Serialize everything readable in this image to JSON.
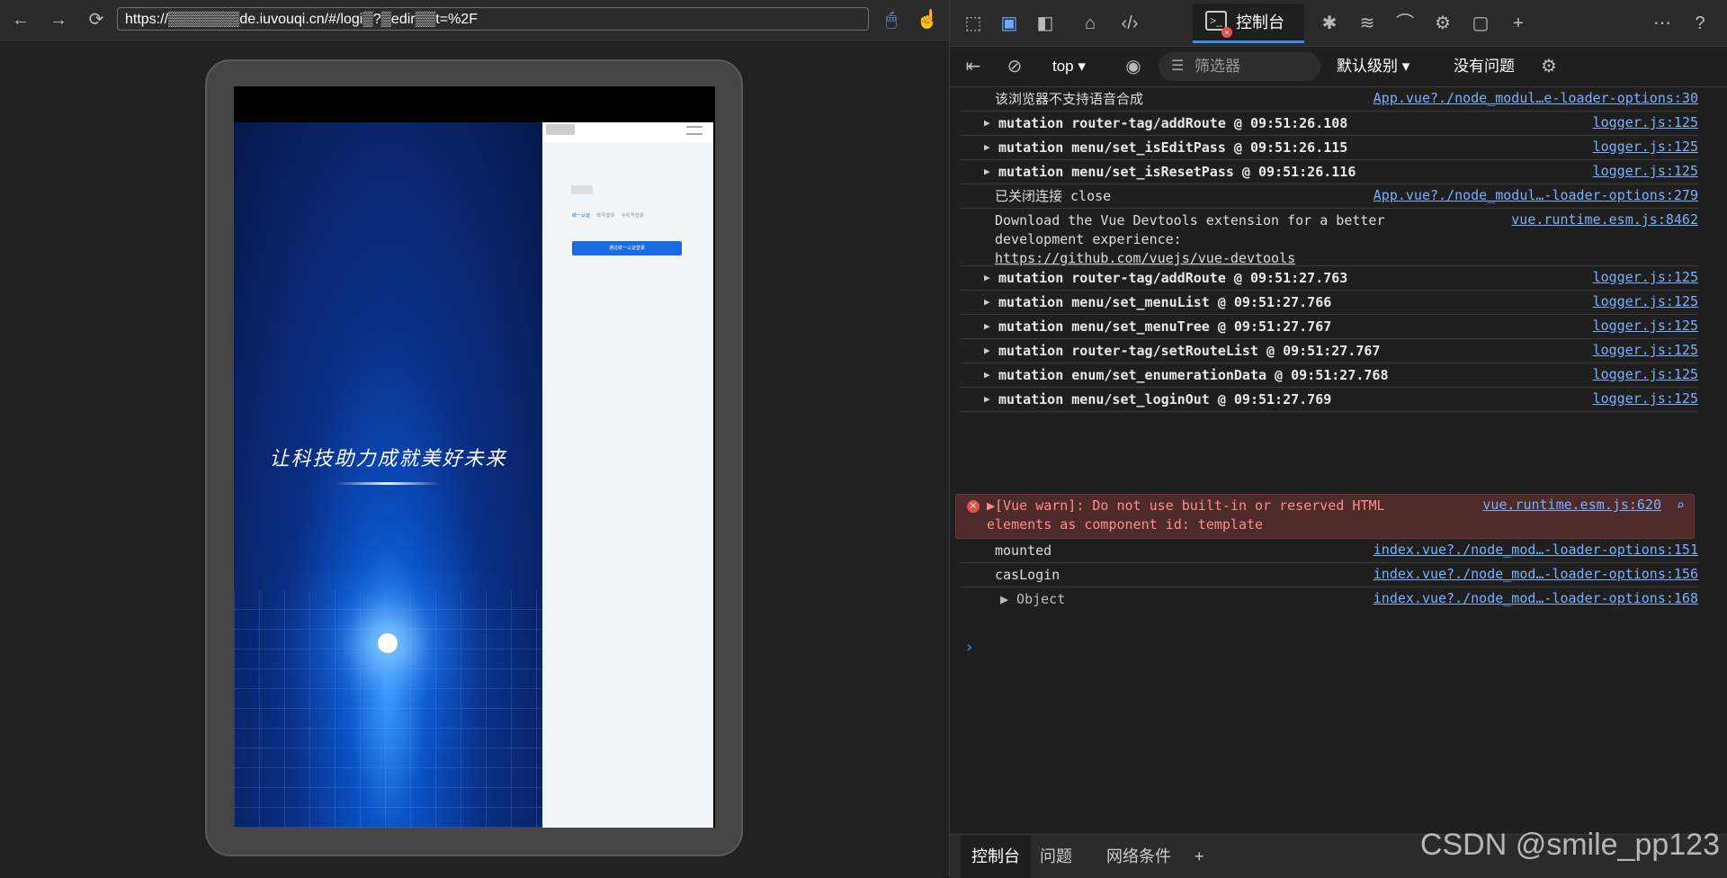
{
  "browser": {
    "url": "https://▒▒▒▒▒▒▒de.iuvouqi.cn/#/logi▒?▒edir▒▒t=%2F"
  },
  "emulated_page": {
    "slogan": "让科技助力成就美好未来",
    "login_tabs": [
      "统一认证",
      "账号登录",
      "手机号登录"
    ],
    "login_button": "通过统一认证登录"
  },
  "devtools": {
    "active_tab": "控制台",
    "toolbar": {
      "context": "top",
      "filter_placeholder": "筛选器",
      "level": "默认级别",
      "issues": "没有问题"
    },
    "console_rows": [
      {
        "msg": "该浏览器不支持语音合成",
        "src": "App.vue?./node_modul…e-loader-options:30"
      },
      {
        "msg": "mutation router-tag/addRoute @ 09:51:26.108",
        "src": "logger.js:125"
      },
      {
        "msg": "mutation menu/set_isEditPass @ 09:51:26.115",
        "src": "logger.js:125"
      },
      {
        "msg": "mutation menu/set_isResetPass @ 09:51:26.116",
        "src": "logger.js:125"
      },
      {
        "msg": "已关闭连接 close",
        "src": "App.vue?./node_modul…-loader-options:279"
      },
      {
        "msg": "Download the Vue Devtools extension for a better\ndevelopment experience:",
        "link": "https://github.com/vuejs/vue-devtools",
        "src": "vue.runtime.esm.js:8462"
      },
      {
        "msg": "mutation router-tag/addRoute @ 09:51:27.763",
        "src": "logger.js:125"
      },
      {
        "msg": "mutation menu/set_menuList @ 09:51:27.766",
        "src": "logger.js:125"
      },
      {
        "msg": "mutation menu/set_menuTree @ 09:51:27.767",
        "src": "logger.js:125"
      },
      {
        "msg": "mutation router-tag/setRouteList @ 09:51:27.767",
        "src": "logger.js:125"
      },
      {
        "msg": "mutation enum/set_enumerationData @ 09:51:27.768",
        "src": "logger.js:125"
      },
      {
        "msg": "mutation menu/set_loginOut @ 09:51:27.769",
        "src": "logger.js:125"
      },
      {
        "msg": "▶[Vue warn]: Do not use built-in or reserved HTML\nelements as component id: template",
        "src": "vue.runtime.esm.js:620"
      },
      {
        "msg": "mounted",
        "src": "index.vue?./node_mod…-loader-options:151"
      },
      {
        "msg": "casLogin",
        "src": "index.vue?./node_mod…-loader-options:156"
      },
      {
        "msg": "▶ Object",
        "src": "index.vue?./node_mod…-loader-options:168"
      }
    ],
    "drawer_tabs": [
      "控制台",
      "问题",
      "网络条件"
    ]
  },
  "watermark": "CSDN @smile_pp123"
}
